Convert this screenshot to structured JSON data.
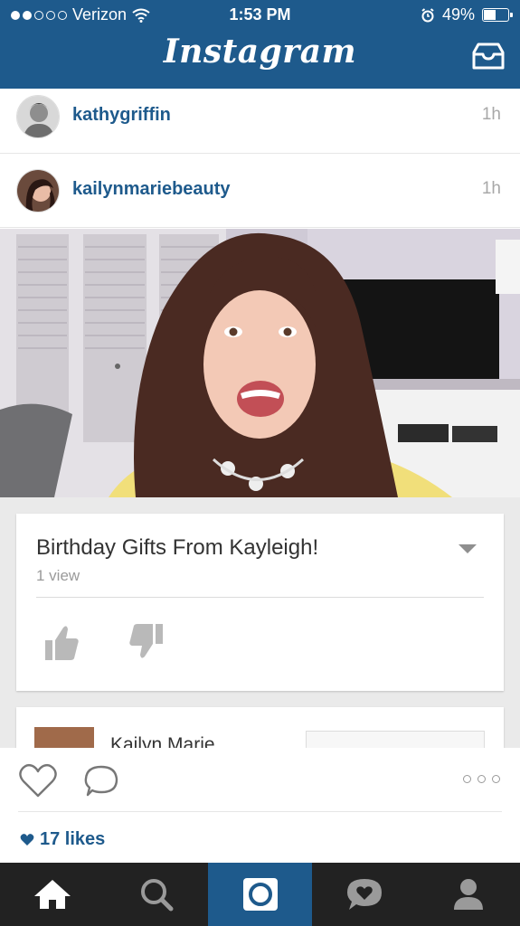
{
  "status_bar": {
    "carrier": "Verizon",
    "signal_bars": "●●○○○",
    "time": "1:53 PM",
    "battery_percent": "49%",
    "battery_level": 0.49
  },
  "header": {
    "title": "Instagram",
    "inbox_icon": "inbox-tray-icon"
  },
  "posts": [
    {
      "username": "kathygriffin",
      "age": "1h"
    },
    {
      "username": "kailynmariebeauty",
      "age": "1h"
    }
  ],
  "video_card": {
    "title": "Birthday Gifts From Kayleigh!",
    "views": "1 view",
    "channel_name": "Kailyn Marie"
  },
  "actions": {
    "likes_text": "17 likes"
  },
  "tabs": [
    {
      "icon": "home-icon",
      "active": false
    },
    {
      "icon": "search-icon",
      "active": false
    },
    {
      "icon": "camera-icon",
      "active": true
    },
    {
      "icon": "activity-icon",
      "active": false
    },
    {
      "icon": "profile-icon",
      "active": false
    }
  ],
  "colors": {
    "brand_blue": "#1e5a8c",
    "tab_bar": "#222222",
    "muted_text": "#a8a8a8"
  }
}
